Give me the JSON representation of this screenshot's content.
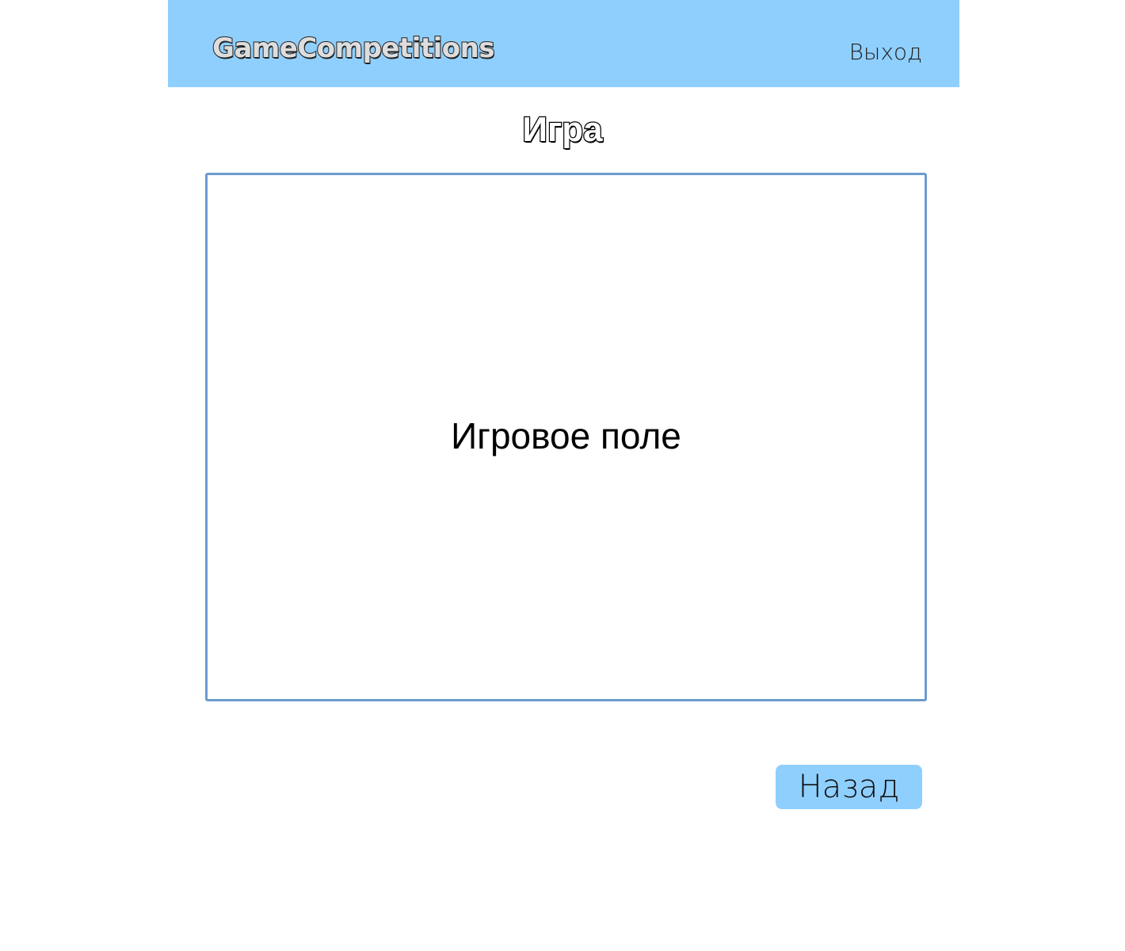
{
  "header": {
    "logo_text": "GameCompetitions",
    "logout_label": "Выход",
    "background_color": "#8fcffe"
  },
  "main": {
    "title": "Игра",
    "game_field_label": "Игровое поле",
    "game_field_border_color": "#6c9bcf",
    "back_button_label": "Назад",
    "back_button_color": "#8fcffe"
  }
}
